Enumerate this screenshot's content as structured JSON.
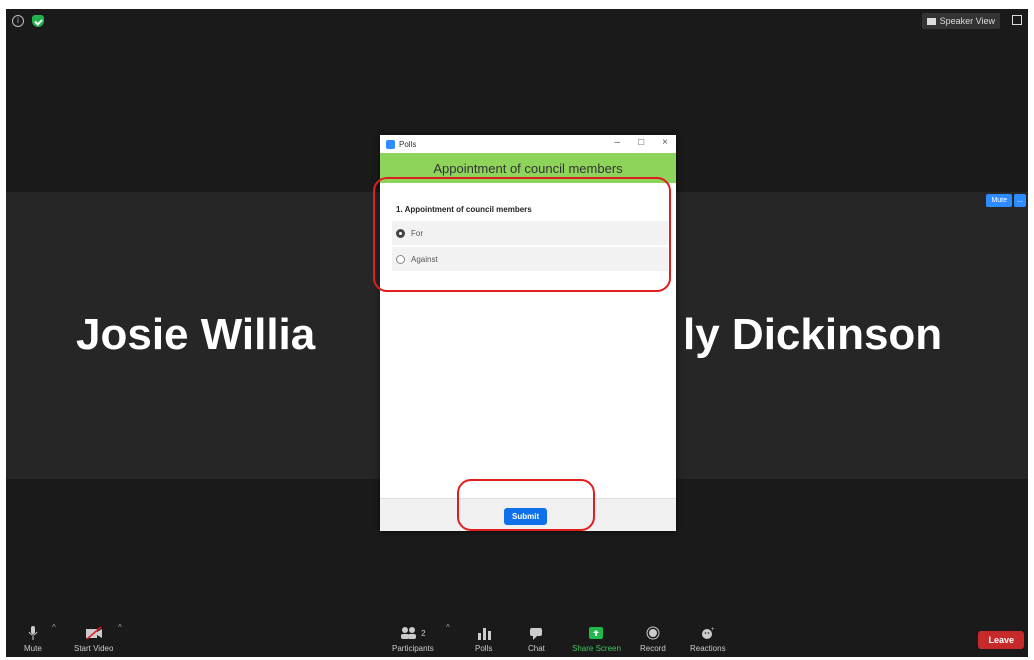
{
  "meeting": {
    "speaker_view_label": "Speaker View",
    "mute_label": "Mute",
    "more_label": "...",
    "participant_left": "Josie Willia",
    "participant_right": "ly Dickinson"
  },
  "toolbar": {
    "mute": "Mute",
    "start_video": "Start Video",
    "participants": "Participants",
    "participants_count": "2",
    "polls": "Polls",
    "chat": "Chat",
    "share_screen": "Share Screen",
    "record": "Record",
    "reactions": "Reactions",
    "leave": "Leave"
  },
  "polls_window": {
    "title": "Polls",
    "header": "Appointment of council members",
    "question": "1. Appointment of council members",
    "options": [
      {
        "label": "For",
        "selected": true
      },
      {
        "label": "Against",
        "selected": false
      }
    ],
    "submit": "Submit"
  },
  "colors": {
    "header_green": "#8fd45a",
    "accent_blue": "#0e71eb",
    "leave_red": "#c62a2a",
    "highlight_red": "#e01e1e"
  }
}
